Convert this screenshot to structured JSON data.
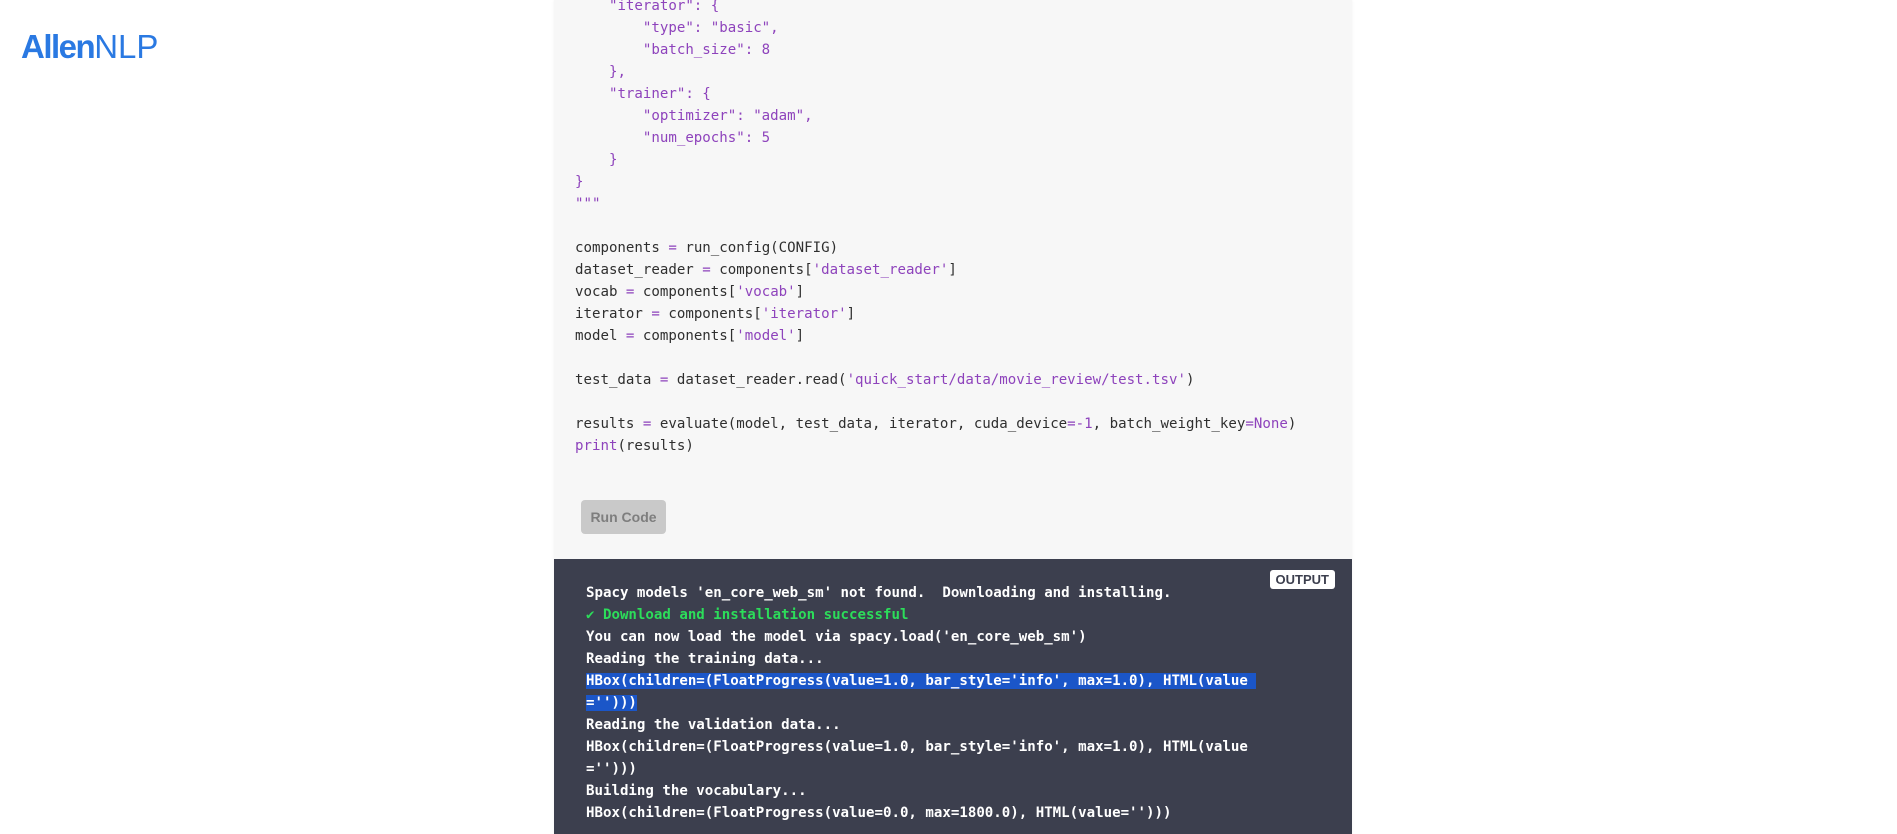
{
  "logo": {
    "part1": "Allen",
    "part2": "NLP"
  },
  "code_lines": [
    [
      {
        "t": "    "
      },
      {
        "t": "\"iterator\": {",
        "c": "p"
      }
    ],
    [
      {
        "t": "        "
      },
      {
        "t": "\"type\": \"basic\",",
        "c": "p"
      }
    ],
    [
      {
        "t": "        "
      },
      {
        "t": "\"batch_size\": 8",
        "c": "p"
      }
    ],
    [
      {
        "t": "    "
      },
      {
        "t": "},",
        "c": "p"
      }
    ],
    [
      {
        "t": "    "
      },
      {
        "t": "\"trainer\": {",
        "c": "p"
      }
    ],
    [
      {
        "t": "        "
      },
      {
        "t": "\"optimizer\": \"adam\",",
        "c": "p"
      }
    ],
    [
      {
        "t": "        "
      },
      {
        "t": "\"num_epochs\": 5",
        "c": "p"
      }
    ],
    [
      {
        "t": "    "
      },
      {
        "t": "}",
        "c": "p"
      }
    ],
    [
      {
        "t": "}",
        "c": "p"
      }
    ],
    [
      {
        "t": "\"\"\"",
        "c": "p"
      }
    ],
    [],
    [
      {
        "t": "components "
      },
      {
        "t": "=",
        "c": "p"
      },
      {
        "t": " run_config(CONFIG)"
      }
    ],
    [
      {
        "t": "dataset_reader "
      },
      {
        "t": "=",
        "c": "p"
      },
      {
        "t": " components["
      },
      {
        "t": "'dataset_reader'",
        "c": "p"
      },
      {
        "t": "]"
      }
    ],
    [
      {
        "t": "vocab "
      },
      {
        "t": "=",
        "c": "p"
      },
      {
        "t": " components["
      },
      {
        "t": "'vocab'",
        "c": "p"
      },
      {
        "t": "]"
      }
    ],
    [
      {
        "t": "iterator "
      },
      {
        "t": "=",
        "c": "p"
      },
      {
        "t": " components["
      },
      {
        "t": "'iterator'",
        "c": "p"
      },
      {
        "t": "]"
      }
    ],
    [
      {
        "t": "model "
      },
      {
        "t": "=",
        "c": "p"
      },
      {
        "t": " components["
      },
      {
        "t": "'model'",
        "c": "p"
      },
      {
        "t": "]"
      }
    ],
    [],
    [
      {
        "t": "test_data "
      },
      {
        "t": "=",
        "c": "p"
      },
      {
        "t": " dataset_reader.read("
      },
      {
        "t": "'quick_start/data/movie_review/test.tsv'",
        "c": "p"
      },
      {
        "t": ")"
      }
    ],
    [],
    [
      {
        "t": "results "
      },
      {
        "t": "=",
        "c": "p"
      },
      {
        "t": " evaluate(model, test_data, iterator, cuda_device"
      },
      {
        "t": "=-1",
        "c": "p"
      },
      {
        "t": ", batch_weight_key"
      },
      {
        "t": "=None",
        "c": "p"
      },
      {
        "t": ")"
      }
    ],
    [
      {
        "t": "print",
        "c": "p"
      },
      {
        "t": "(results)"
      }
    ]
  ],
  "run_button": {
    "label": "Run Code"
  },
  "output": {
    "label": "OUTPUT",
    "lines": [
      {
        "t": "Spacy models 'en_core_web_sm' not found.  Downloading and installing."
      },
      {
        "t": "✔ Download and installation successful",
        "c": "ok"
      },
      {
        "t": "You can now load the model via spacy.load('en_core_web_sm')"
      },
      {
        "t": "Reading the training data..."
      },
      {
        "t": "HBox(children=(FloatProgress(value=1.0, bar_style='info', max=1.0), HTML(value ",
        "c": "hl"
      },
      {
        "t": "='')))",
        "c": "hl"
      },
      {
        "t": "Reading the validation data..."
      },
      {
        "t": "HBox(children=(FloatProgress(value=1.0, bar_style='info', max=1.0), HTML(value"
      },
      {
        "t": "='')))"
      },
      {
        "t": "Building the vocabulary..."
      },
      {
        "t": "HBox(children=(FloatProgress(value=0.0, max=1800.0), HTML(value='')))"
      }
    ]
  },
  "colors": {
    "accent": "#2a79e2",
    "code_purple": "#8e43bc",
    "output_bg": "#3c3f4e",
    "success_green": "#2cdd5a",
    "selection_blue": "#1b56c8"
  }
}
